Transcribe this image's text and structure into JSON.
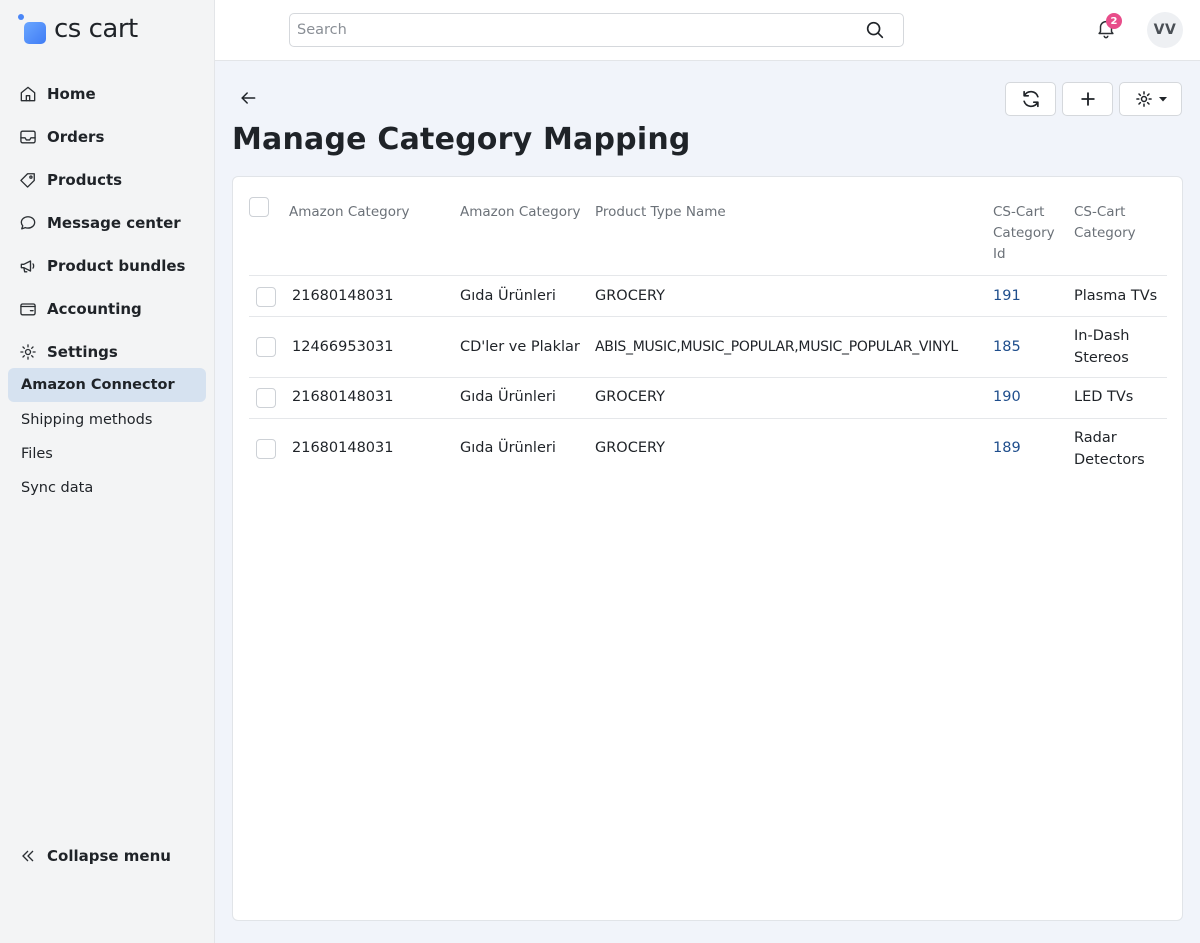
{
  "brand": {
    "name": "cs cart"
  },
  "sidebar": {
    "items": [
      {
        "label": "Home",
        "icon": "home-icon"
      },
      {
        "label": "Orders",
        "icon": "inbox-icon"
      },
      {
        "label": "Products",
        "icon": "tag-icon"
      },
      {
        "label": "Message center",
        "icon": "chat-icon"
      },
      {
        "label": "Product bundles",
        "icon": "megaphone-icon"
      },
      {
        "label": "Accounting",
        "icon": "wallet-icon"
      },
      {
        "label": "Settings",
        "icon": "gear-icon"
      }
    ],
    "subitems": [
      {
        "label": "Amazon Connector",
        "active": true
      },
      {
        "label": "Shipping methods",
        "active": false
      },
      {
        "label": "Files",
        "active": false
      },
      {
        "label": "Sync data",
        "active": false
      }
    ],
    "collapse_label": "Collapse menu"
  },
  "header": {
    "search_placeholder": "Search",
    "notifications_count": "2",
    "avatar_initials": "VV"
  },
  "page": {
    "title": "Manage Category Mapping"
  },
  "table": {
    "headers": [
      "Amazon Category",
      "Amazon Category",
      "Product Type Name",
      "CS-Cart Category Id",
      "CS-Cart Category"
    ],
    "rows": [
      {
        "amazon_id": "21680148031",
        "amazon_name": "Gıda Ürünleri",
        "product_type": "GROCERY",
        "cscart_id": "191",
        "cscart_name": "Plasma TVs"
      },
      {
        "amazon_id": "12466953031",
        "amazon_name": "CD'ler ve Plaklar",
        "product_type": "ABIS_MUSIC,MUSIC_POPULAR,MUSIC_POPULAR_VINYL",
        "cscart_id": "185",
        "cscart_name": "In-Dash Stereos"
      },
      {
        "amazon_id": "21680148031",
        "amazon_name": "Gıda Ürünleri",
        "product_type": "GROCERY",
        "cscart_id": "190",
        "cscart_name": "LED TVs"
      },
      {
        "amazon_id": "21680148031",
        "amazon_name": "Gıda Ürünleri",
        "product_type": "GROCERY",
        "cscart_id": "189",
        "cscart_name": "Radar Detectors"
      }
    ]
  },
  "colors": {
    "accent": "#3f7cf5",
    "badge": "#e84d8a",
    "link": "#1f4e8c",
    "active_nav": "#d6e2f0"
  }
}
